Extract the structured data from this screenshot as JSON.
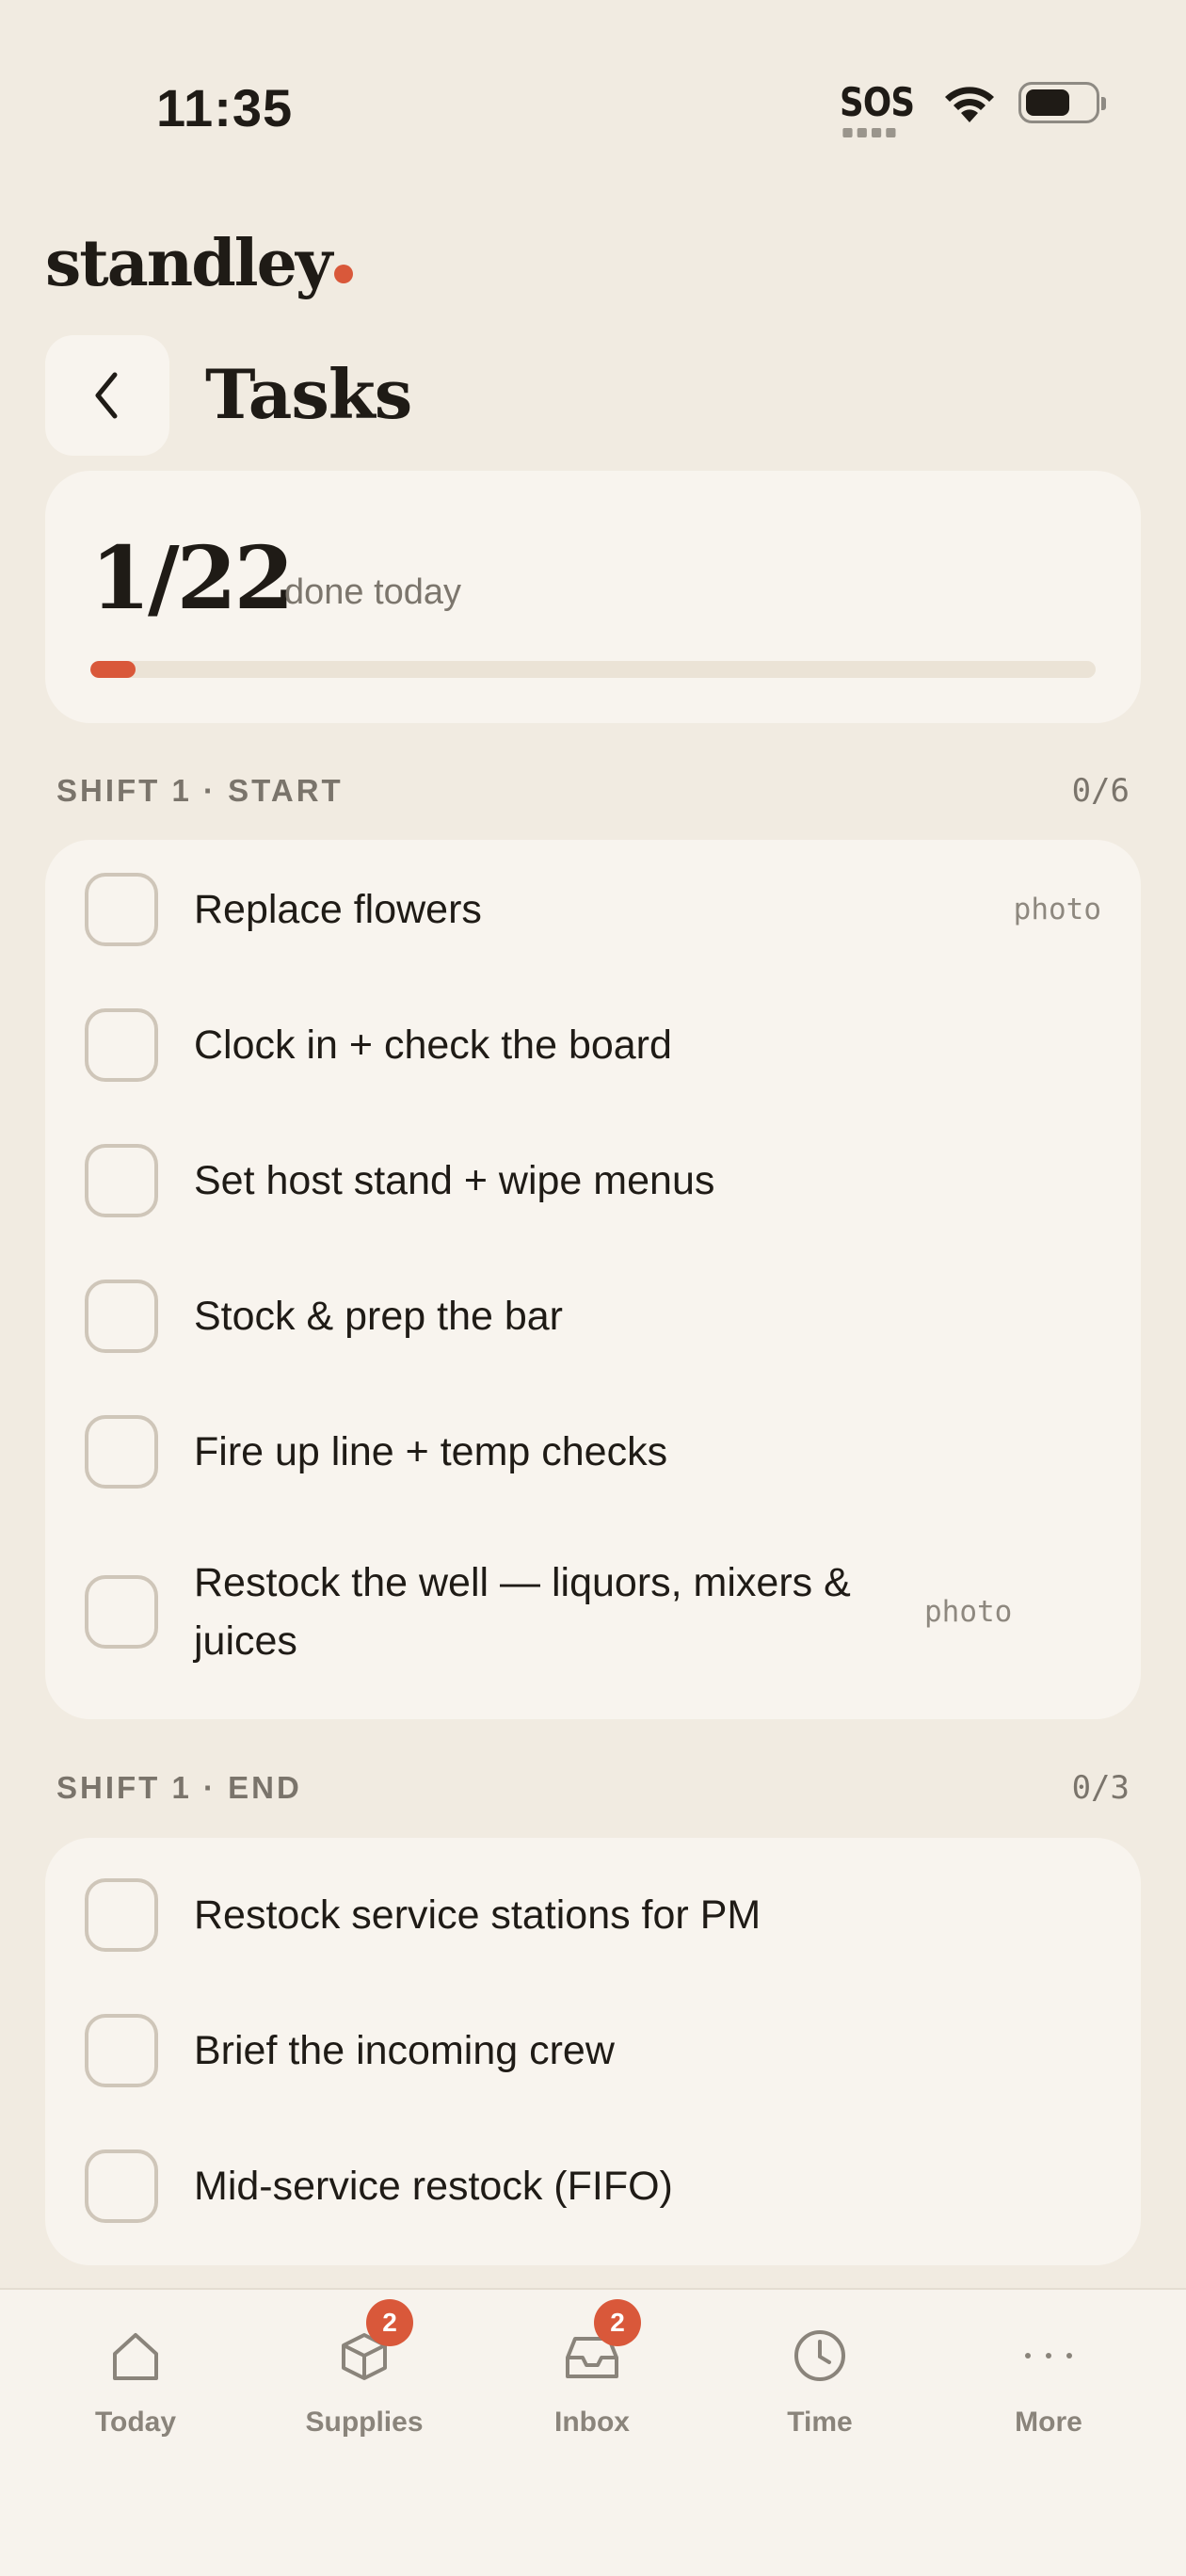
{
  "status_bar": {
    "time": "11:35",
    "sos": "SOS"
  },
  "brand": {
    "name": "standley"
  },
  "header": {
    "title": "Tasks"
  },
  "progress": {
    "count": "1/22",
    "label": "done today",
    "fraction": 0.045
  },
  "sections": [
    {
      "title": "SHIFT 1 · START",
      "count": "0/6",
      "tasks": [
        {
          "label": "Replace flowers",
          "tag": "photo"
        },
        {
          "label": "Clock in + check the board",
          "tag": ""
        },
        {
          "label": "Set host stand + wipe menus",
          "tag": ""
        },
        {
          "label": "Stock & prep the bar",
          "tag": ""
        },
        {
          "label": "Fire up line + temp checks",
          "tag": ""
        },
        {
          "label": "Restock the well — liquors, mixers & juices",
          "tag": "photo"
        }
      ]
    },
    {
      "title": "SHIFT 1 · END",
      "count": "0/3",
      "tasks": [
        {
          "label": "Restock service stations for PM",
          "tag": ""
        },
        {
          "label": "Brief the incoming crew",
          "tag": ""
        },
        {
          "label": "Mid-service restock (FIFO)",
          "tag": ""
        }
      ]
    }
  ],
  "nav": [
    {
      "label": "Today",
      "icon": "home-icon",
      "badge": ""
    },
    {
      "label": "Supplies",
      "icon": "box-icon",
      "badge": "2"
    },
    {
      "label": "Inbox",
      "icon": "inbox-icon",
      "badge": "2"
    },
    {
      "label": "Time",
      "icon": "clock-icon",
      "badge": ""
    },
    {
      "label": "More",
      "icon": "more-icon",
      "badge": ""
    }
  ],
  "colors": {
    "accent": "#d9583a",
    "background": "#f1ebe1",
    "card": "#f8f4ee"
  }
}
